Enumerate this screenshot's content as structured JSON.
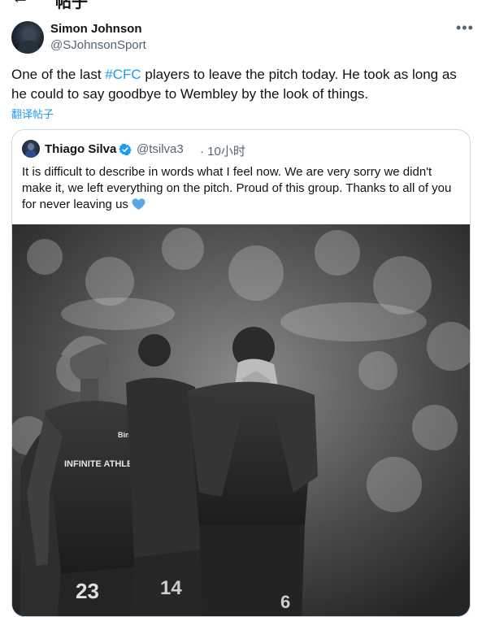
{
  "header": {
    "back_icon": "back-arrow-icon",
    "title": "帖子"
  },
  "tweet": {
    "author_name": "Simon Johnson",
    "author_handle": "@SJohnsonSport",
    "more_icon": "more-icon",
    "text_before": "One of the last ",
    "hashtag": "#CFC",
    "text_after": " players to leave the pitch today. He took as long as he could to say goodbye to Wembley by the look of things.",
    "translate_label": "翻译帖子"
  },
  "quote": {
    "author_name": "Thiago Silva",
    "author_handle": "@tsilva3",
    "separator": "·",
    "time": "10小时",
    "text": "It is difficult to describe in words what I feel now. We are very sorry we didn't make it, we left everything on the pitch. Proud of this group. Thanks to all of you for never leaving us",
    "emoji_icon": "blue-heart-icon",
    "photo": {
      "description_icon": "photo",
      "shirt_sponsor_left": "INFINITE ATHLETE",
      "shirt_sponsor_brand": "BingX",
      "number_left": "23",
      "number_center": "14",
      "number_right": "6"
    }
  },
  "colors": {
    "accent": "#1d9bf0",
    "text": "#0f1419",
    "muted": "#536471",
    "border": "#cfd9de",
    "heart": "#5aa9e6"
  }
}
